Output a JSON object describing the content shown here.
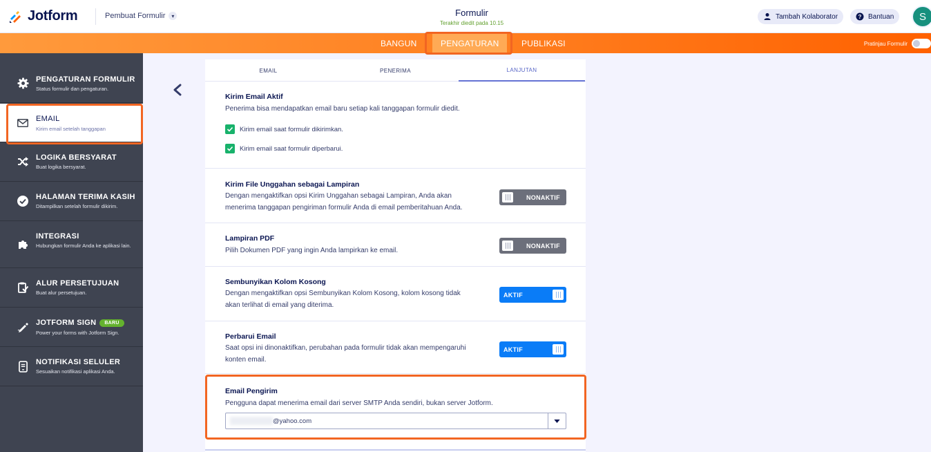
{
  "header": {
    "app_name": "Jotform",
    "builder_label": "Pembuat Formulir",
    "form_title": "Formulir",
    "last_edited": "Terakhir diedit pada 10.15",
    "add_collaborator": "Tambah Kolaborator",
    "help": "Bantuan",
    "avatar_initial": "S"
  },
  "nav": {
    "tabs": [
      "BANGUN",
      "PENGATURAN",
      "PUBLIKASI"
    ],
    "active": "PENGATURAN",
    "preview_label": "Pratinjau Formulir",
    "preview_enabled": false
  },
  "sidebar": {
    "items": [
      {
        "title": "PENGATURAN FORMULIR",
        "desc": "Status formulir dan pengaturan.",
        "icon": "gear-icon"
      },
      {
        "title": "EMAIL",
        "desc": "Kirim email setelah tanggapan",
        "icon": "envelope-icon",
        "active": true
      },
      {
        "title": "LOGIKA BERSYARAT",
        "desc": "Buat logika bersyarat.",
        "icon": "shuffle-icon"
      },
      {
        "title": "HALAMAN TERIMA KASIH",
        "desc": "Ditampilkan setelah formulir dikirim.",
        "icon": "check-circle-icon"
      },
      {
        "title": "INTEGRASI",
        "desc": "Hubungkan formulir Anda ke aplikasi lain.",
        "icon": "puzzle-icon"
      },
      {
        "title": "ALUR PERSETUJUAN",
        "desc": "Buat alur persetujuan.",
        "icon": "clipboard-check-icon"
      },
      {
        "title": "JOTFORM SIGN",
        "desc": "Power your forms with Jotform Sign.",
        "icon": "pen-icon",
        "badge": "BARU"
      },
      {
        "title": "NOTIFIKASI SELULER",
        "desc": "Sesuaikan notifikasi aplikasi Anda.",
        "icon": "mobile-icon"
      }
    ]
  },
  "subtabs": {
    "items": [
      "EMAIL",
      "PENERIMA",
      "LANJUTAN"
    ],
    "active": "LANJUTAN"
  },
  "sections": {
    "send_active": {
      "title": "Kirim Email Aktif",
      "desc": "Penerima bisa mendapatkan email baru setiap kali tanggapan formulir diedit.",
      "check1": "Kirim email saat formulir dikirimkan.",
      "check1_checked": true,
      "check2": "Kirim email saat formulir diperbarui.",
      "check2_checked": true
    },
    "attach_uploads": {
      "title": "Kirim File Unggahan sebagai Lampiran",
      "desc1": "Dengan mengaktifkan opsi Kirim Unggahan sebagai Lampiran, Anda akan",
      "desc2": "menerima tanggapan pengiriman formulir Anda di email pemberitahuan Anda.",
      "toggle": "NONAKTIF"
    },
    "pdf": {
      "title": "Lampiran PDF",
      "desc": "Pilih Dokumen PDF yang ingin Anda lampirkan ke email.",
      "toggle": "NONAKTIF"
    },
    "hide_empty": {
      "title": "Sembunyikan Kolom Kosong",
      "desc1": "Dengan mengaktifkan opsi Sembunyikan Kolom Kosong, kolom kosong tidak",
      "desc2": "akan terlihat di email yang diterima.",
      "toggle": "AKTIF"
    },
    "update_email": {
      "title": "Perbarui Email",
      "desc1": "Saat opsi ini dinonaktifkan, perubahan pada formulir tidak akan mempengaruhi",
      "desc2": "konten email.",
      "toggle": "AKTIF"
    },
    "sender": {
      "title": "Email Pengirim",
      "desc": "Pengguna dapat menerima email dari server SMTP Anda sendiri, bukan server Jotform.",
      "value": "@yahoo.com"
    }
  },
  "colors": {
    "orange": "#ff7b1c",
    "highlight": "#f26522",
    "sidebar": "#3f4451",
    "toggle_on": "#0a7cf7",
    "toggle_off": "#6c6f7b",
    "checkbox": "#18b26b"
  }
}
